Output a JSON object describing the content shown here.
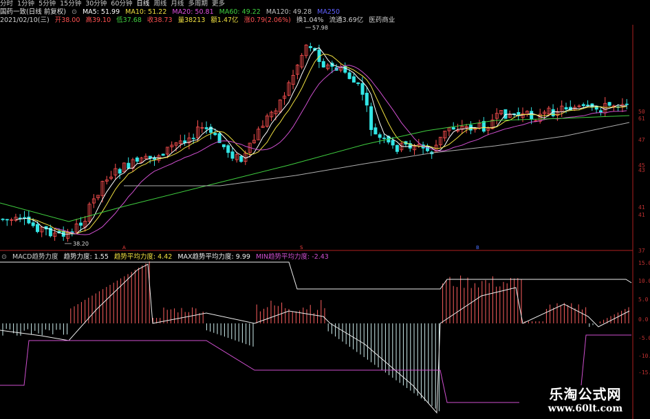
{
  "timeframes": [
    "分时",
    "1分钟",
    "5分钟",
    "15分钟",
    "30分钟",
    "60分钟",
    "日线",
    "周线",
    "月线",
    "多周期",
    "更多"
  ],
  "active_timeframe": "日线",
  "stock": {
    "name": "国药一致(日线 前复权)"
  },
  "ma": {
    "ma5": "MA5: 51.99",
    "ma10": "MA10: 51.22",
    "ma20": "MA20: 50.81",
    "ma60": "MA60: 49.22",
    "ma120": "MA120: 49.28",
    "ma_extra": "MA250"
  },
  "info": {
    "date": "2021/02/10(三)",
    "open": "开38.00",
    "high": "高39.10",
    "low": "低37.68",
    "close": "收38.73",
    "volume": "量38213",
    "amount": "额1.47亿",
    "change": "涨0.79(2.06%)",
    "turnover": "换1.04%",
    "float_cap": "流通3.69亿",
    "sector": "医药商业"
  },
  "annotations": {
    "high": "57.98",
    "low": "38.20"
  },
  "price_axis": [
    "50",
    "61",
    "47",
    "45",
    "43",
    "41",
    "41",
    "37"
  ],
  "markers": {
    "m1": "A",
    "m2": "B",
    "m3": "S"
  },
  "macd": {
    "title": "MACD趋势力度",
    "trend": "趋势力度: 1.55",
    "avg": "趋势平均力度: 4.42",
    "max": "MAX趋势平均力度: 9.99",
    "min": "MIN趋势平均力度: -2.43"
  },
  "macd_axis": [
    "15.0",
    "10.0",
    "5.0",
    "0.0",
    "-5.0",
    "-10.0",
    "-15.0"
  ],
  "colors": {
    "up": "#ff5050",
    "down": "#33e5e5",
    "ma5": "#ffffff",
    "ma10": "#f0e040",
    "ma20": "#d050d0",
    "ma60": "#40d040",
    "ma120": "#b0b0b0",
    "axis": "#b02020"
  },
  "watermark": {
    "title": "乐淘公式网",
    "url": "www.60lt.com"
  }
}
